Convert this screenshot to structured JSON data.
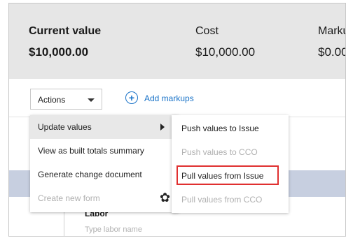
{
  "summary": {
    "current": {
      "label": "Current value",
      "value": "$10,000.00"
    },
    "cost": {
      "label": "Cost",
      "value": "$10,000.00"
    },
    "markup": {
      "label": "Marku",
      "value": "$0.00"
    }
  },
  "toolbar": {
    "actions_label": "Actions",
    "add_markups_label": "Add markups",
    "plus_glyph": "+"
  },
  "actions_menu": {
    "items": [
      {
        "label": "Update values",
        "state": "active",
        "icon": "triangle-right-icon"
      },
      {
        "label": "View as built totals summary",
        "state": "enabled"
      },
      {
        "label": "Generate change document",
        "state": "enabled"
      },
      {
        "label": "Create new form",
        "state": "disabled",
        "icon": "gear-icon"
      }
    ]
  },
  "submenu": {
    "items": [
      {
        "label": "Push values to Issue",
        "state": "enabled"
      },
      {
        "label": "Push values to CCO",
        "state": "disabled"
      },
      {
        "label": "Pull values from Issue",
        "state": "highlighted"
      },
      {
        "label": "Pull values from CCO",
        "state": "disabled"
      }
    ],
    "highlight_color": "#e03030"
  },
  "table": {
    "row_label": "Labor",
    "row_sub": "Type labor name",
    "plus_glyph": "+"
  },
  "colors": {
    "accent": "#1a73c8",
    "summary_bg": "#e6e6e6",
    "table_band": "#c7cfe0",
    "disabled_text": "#b0b0b0"
  },
  "icons": {
    "gear": "✿"
  }
}
